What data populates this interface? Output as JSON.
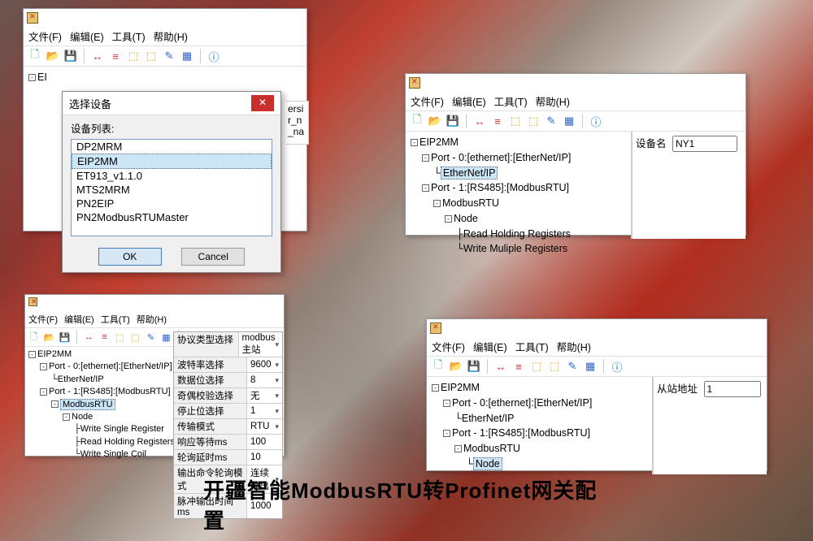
{
  "caption": "开疆智能ModbusRTU转Profinet网关配置",
  "menus": {
    "file": "文件(F)",
    "edit": "编辑(E)",
    "tool": "工具(T)",
    "help": "帮助(H)"
  },
  "toolbar_icons": {
    "new": "🗋",
    "open": "📂",
    "save": "💾",
    "t1": "↔",
    "t2": "≡",
    "t3": "⬚",
    "t4": "⬚",
    "t5": "✎",
    "t6": "▦",
    "info": "ⓘ"
  },
  "dialog": {
    "title": "选择设备",
    "list_label": "设备列表:",
    "items": [
      "DP2MRM",
      "EIP2MM",
      "ET913_v1.1.0",
      "MTS2MRM",
      "PN2EIP",
      "PN2ModbusRTUMaster"
    ],
    "selected": "EIP2MM",
    "ok": "OK",
    "cancel": "Cancel"
  },
  "partial_text": {
    "l1": "ersi",
    "l2": "r_n",
    "l3": "_na"
  },
  "win1_tree_root": "EI",
  "win2": {
    "root": "EIP2MM",
    "port0": "Port - 0:[ethernet]:[EtherNet/IP]",
    "ethip": "EtherNet/IP",
    "port1": "Port - 1:[RS485]:[ModbusRTU]",
    "modbus": "ModbusRTU",
    "node": "Node",
    "rhr": "Read Holding Registers",
    "wmr": "Write Muliple Registers",
    "prop_label": "设备名",
    "prop_value": "NY1"
  },
  "win3": {
    "root": "EIP2MM",
    "port0": "Port - 0:[ethernet]:[EtherNet/IP]",
    "ethip": "EtherNet/IP",
    "port1": "Port - 1:[RS485]:[ModbusRTU]",
    "modbus": "ModbusRTU",
    "node": "Node",
    "wsr": "Write Single Register",
    "rhr": "Read Holding Registers",
    "wsc": "Write Single Coil",
    "grid": [
      {
        "k": "协议类型选择",
        "v": "modbus主站",
        "dd": true
      },
      {
        "k": "波特率选择",
        "v": "9600",
        "dd": true
      },
      {
        "k": "数据位选择",
        "v": "8",
        "dd": true
      },
      {
        "k": "奇偶校验选择",
        "v": "无",
        "dd": true
      },
      {
        "k": "停止位选择",
        "v": "1",
        "dd": true
      },
      {
        "k": "传输模式",
        "v": "RTU",
        "dd": true
      },
      {
        "k": "响应等待ms",
        "v": "100",
        "dd": false
      },
      {
        "k": "轮询延时ms",
        "v": "10",
        "dd": false
      },
      {
        "k": "输出命令轮询模式",
        "v": "连续输出",
        "dd": true
      },
      {
        "k": "脉冲输出时间ms",
        "v": "1000",
        "dd": false
      }
    ]
  },
  "win4": {
    "root": "EIP2MM",
    "port0": "Port - 0:[ethernet]:[EtherNet/IP]",
    "ethip": "EtherNet/IP",
    "port1": "Port - 1:[RS485]:[ModbusRTU]",
    "modbus": "ModbusRTU",
    "node": "Node",
    "prop_label": "从站地址",
    "prop_value": "1"
  }
}
